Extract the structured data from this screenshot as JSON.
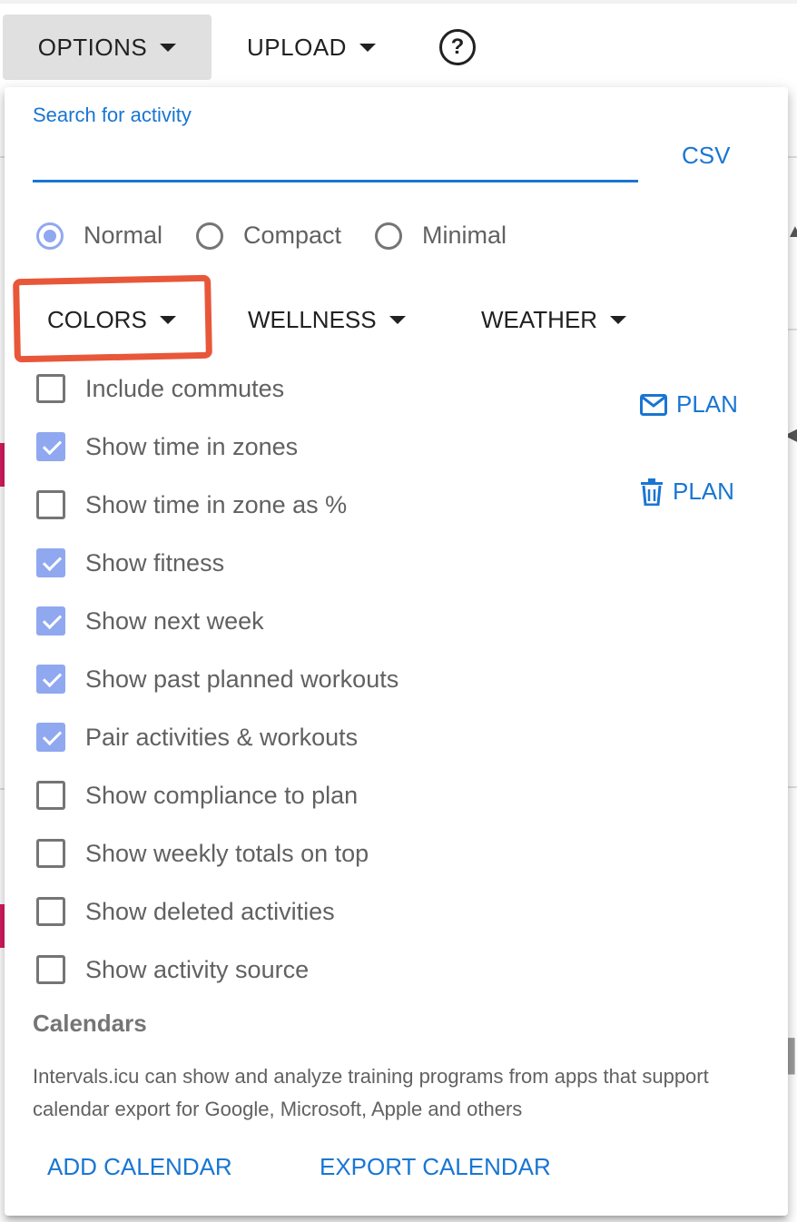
{
  "toolbar": {
    "options_label": "OPTIONS",
    "upload_label": "UPLOAD",
    "help_glyph": "?"
  },
  "search": {
    "label": "Search for activity",
    "value": ""
  },
  "csv_label": "CSV",
  "view_modes": [
    {
      "label": "Normal",
      "selected": true
    },
    {
      "label": "Compact",
      "selected": false
    },
    {
      "label": "Minimal",
      "selected": false
    }
  ],
  "sub_menus": {
    "colors": "COLORS",
    "wellness": "WELLNESS",
    "weather": "WEATHER"
  },
  "options": [
    {
      "label": "Include commutes",
      "checked": false
    },
    {
      "label": "Show time in zones",
      "checked": true
    },
    {
      "label": "Show time in zone as %",
      "checked": false
    },
    {
      "label": "Show fitness",
      "checked": true
    },
    {
      "label": "Show next week",
      "checked": true
    },
    {
      "label": "Show past planned workouts",
      "checked": true
    },
    {
      "label": "Pair activities & workouts",
      "checked": true
    },
    {
      "label": "Show compliance to plan",
      "checked": false
    },
    {
      "label": "Show weekly totals on top",
      "checked": false
    },
    {
      "label": "Show deleted activities",
      "checked": false
    },
    {
      "label": "Show activity source",
      "checked": false
    }
  ],
  "plan_actions": [
    {
      "label": "PLAN",
      "icon": "mail-icon"
    },
    {
      "label": "PLAN",
      "icon": "trash-icon"
    }
  ],
  "calendars": {
    "heading": "Calendars",
    "description": "Intervals.icu can show and analyze training programs from apps that support calendar export for Google, Microsoft, Apple and others",
    "add_label": "ADD CALENDAR",
    "export_label": "EXPORT CALENDAR"
  },
  "colors": {
    "accent": "#1976d2",
    "checkbox_checked": "#90a8f0",
    "annotation": "#e8573a"
  }
}
